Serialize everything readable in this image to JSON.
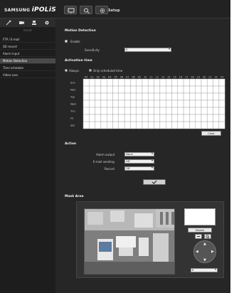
{
  "header": {
    "logo_brand": "SAMSUNG",
    "logo_product": "iPOLiS",
    "title": "Setup",
    "tabs": [
      {
        "name": "monitor-icon"
      },
      {
        "name": "search-icon"
      },
      {
        "name": "gear-icon"
      }
    ]
  },
  "sidebar": {
    "category": "Event",
    "items": [
      {
        "label": "FTP / E-mail",
        "active": false
      },
      {
        "label": "SD record",
        "active": false
      },
      {
        "label": "Alarm input",
        "active": false
      },
      {
        "label": "Motion Detection",
        "active": true
      },
      {
        "label": "Time schedule",
        "active": false
      },
      {
        "label": "Video Loss",
        "active": false
      }
    ]
  },
  "motion_detection": {
    "title": "Motion Detection",
    "enable_label": "Enable",
    "sensitivity_label": "Sensitivity",
    "sensitivity_value": "5"
  },
  "activation_time": {
    "title": "Activation time",
    "always_label": "Always",
    "scheduled_label": "Only scheduled time",
    "hours": [
      "00",
      "01",
      "02",
      "03",
      "04",
      "05",
      "06",
      "07",
      "08",
      "09",
      "10",
      "11",
      "12",
      "13",
      "14",
      "15",
      "16",
      "17",
      "18",
      "19",
      "20",
      "21",
      "22",
      "23"
    ],
    "days": [
      "Sun",
      "Mon",
      "Tue",
      "Wed",
      "Thu",
      "Fri",
      "Sat"
    ],
    "clear_label": "Clear"
  },
  "action": {
    "title": "Action",
    "alarm_output_label": "Alarm output",
    "alarm_output_value": "None",
    "email_label": "E-mail sending",
    "email_value": "Off",
    "record_label": "Record",
    "record_value": "Off"
  },
  "mask_area": {
    "title": "Mask Area",
    "delete_label": "Delete",
    "zoom_value": "6"
  }
}
